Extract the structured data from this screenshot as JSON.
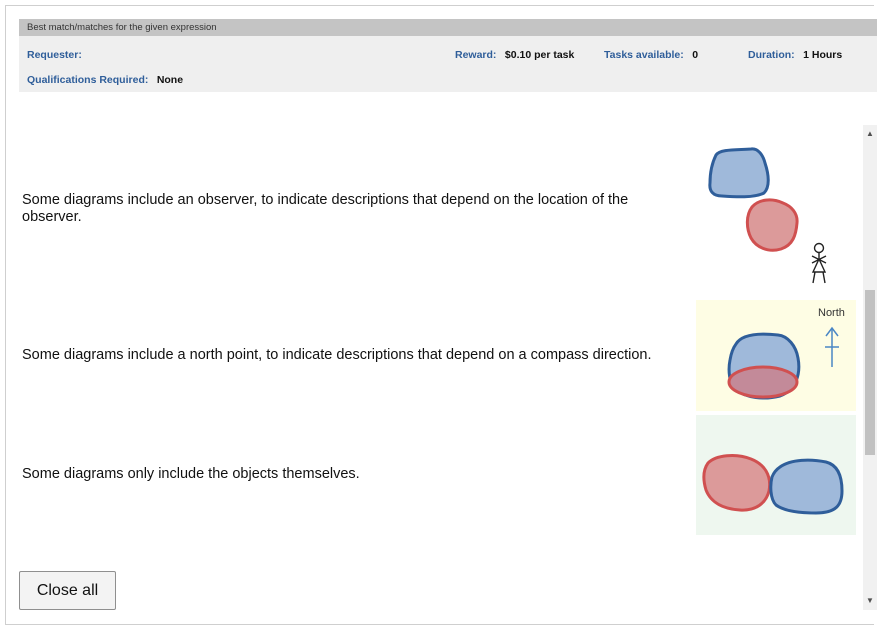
{
  "hit": {
    "title": "Best match/matches for the given expression",
    "requester_label": "Requester:",
    "requester_value": "",
    "reward_label": "Reward:",
    "reward_value": "$0.10 per task",
    "tasks_label": "Tasks available:",
    "tasks_value": "0",
    "duration_label": "Duration:",
    "duration_value": "1 Hours",
    "qual_label": "Qualifications Required:",
    "qual_value": "None"
  },
  "instructions": {
    "rows": [
      {
        "text": "Some diagrams include an observer, to indicate descriptions that depend on the location of the observer.",
        "icon": "observer-diagram"
      },
      {
        "text": "Some diagrams include a north point, to indicate descriptions that depend on a compass direction.",
        "icon": "north-point-diagram",
        "north_label": "North"
      },
      {
        "text": "Some diagrams only include the objects themselves.",
        "icon": "objects-only-diagram"
      }
    ]
  },
  "colors": {
    "blue_fill": "#9fb9da",
    "blue_stroke": "#2f5e9a",
    "red_fill": "#dc9a9a",
    "red_stroke": "#d05050",
    "north_panel_bg": "#fefde4",
    "objects_panel_bg": "#eef7ef"
  },
  "buttons": {
    "close_all": "Close all"
  }
}
